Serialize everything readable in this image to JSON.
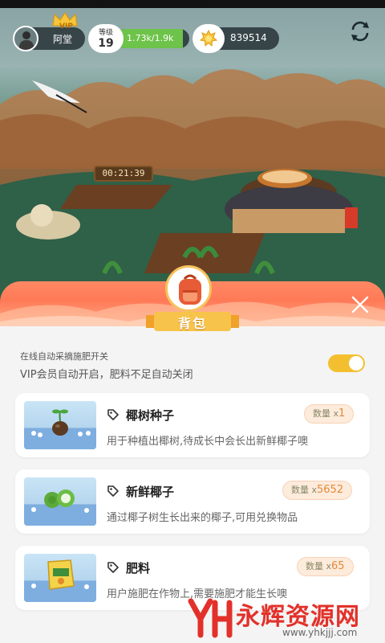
{
  "hud": {
    "player_name": "阿堂",
    "vip_label": "VIP",
    "level_label": "等级",
    "level_value": "19",
    "xp_text": "1.73k/1.9k",
    "xp_progress": 0.91,
    "coins": "839514"
  },
  "scene": {
    "timer": "00:21:39"
  },
  "panel": {
    "title": "背包",
    "auto_title": "在线自动采摘施肥开关",
    "auto_desc": "VIP会员自动开启，肥料不足自动关闭",
    "auto_toggle_on": true
  },
  "items": [
    {
      "name": "椰树种子",
      "qty_label": "数量 x",
      "qty": "1",
      "desc": "用于种植出椰树,待成长中会长出新鲜椰子噢"
    },
    {
      "name": "新鲜椰子",
      "qty_label": "数量 x",
      "qty": "5652",
      "desc": "通过椰子树生长出来的椰子,可用兑换物品"
    },
    {
      "name": "肥料",
      "qty_label": "数量 x",
      "qty": "65",
      "desc": "用户施肥在作物上,需要施肥才能生长噢"
    }
  ],
  "watermark": {
    "text": "永辉资源网",
    "url": "www.yhkjjj.com"
  },
  "colors": {
    "accent_orange": "#ff7a57",
    "toggle_on": "#f4bf2f",
    "xp_green": "#6ec34a",
    "qty_value": "#e38a3a"
  },
  "icons": [
    "crown-icon",
    "coin-icon",
    "sync-icon",
    "backpack-icon",
    "close-icon",
    "tag-icon",
    "seed-icon",
    "coconut-icon",
    "fertilizer-icon"
  ]
}
